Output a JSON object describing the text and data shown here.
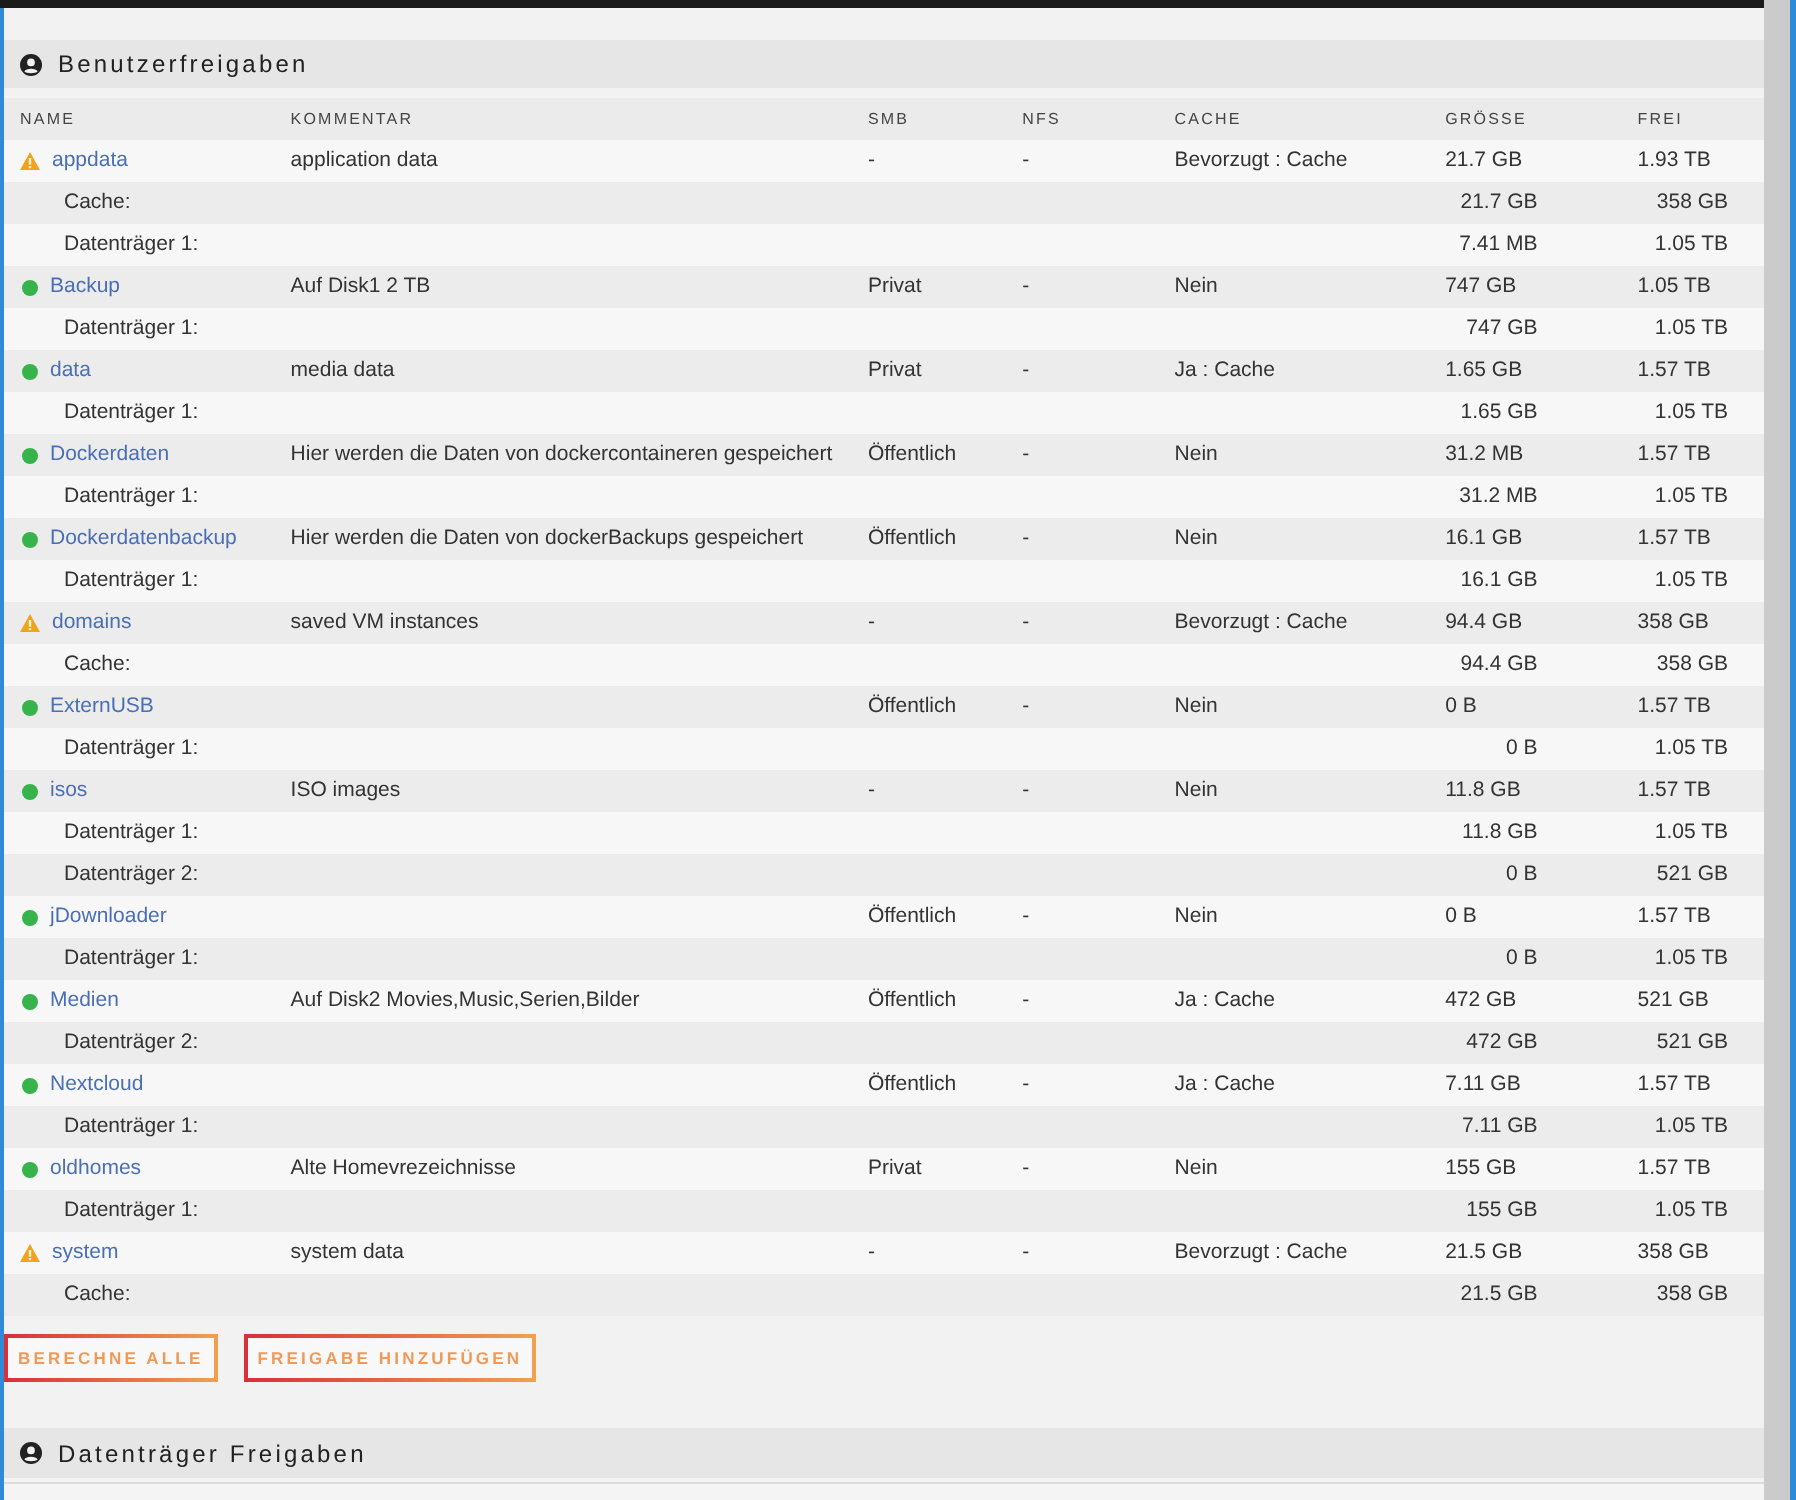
{
  "user_shares": {
    "title": "Benutzerfreigaben",
    "columns": [
      "NAME",
      "KOMMENTAR",
      "SMB",
      "NFS",
      "CACHE",
      "GRÖSSE",
      "FREI"
    ],
    "shares": [
      {
        "name": "appdata",
        "warning": true,
        "comment": "application data",
        "smb": "-",
        "nfs": "-",
        "cache": "Bevorzugt : Cache",
        "size": "21.7 GB",
        "free": "1.93 TB",
        "disks": [
          {
            "label": "Cache:",
            "size": "21.7 GB",
            "free": "358 GB"
          },
          {
            "label": "Datenträger 1:",
            "size": "7.41 MB",
            "free": "1.05 TB"
          }
        ]
      },
      {
        "name": "Backup",
        "warning": false,
        "comment": "Auf Disk1 2 TB",
        "smb": "Privat",
        "nfs": "-",
        "cache": "Nein",
        "size": "747 GB",
        "free": "1.05 TB",
        "disks": [
          {
            "label": "Datenträger 1:",
            "size": "747 GB",
            "free": "1.05 TB"
          }
        ]
      },
      {
        "name": "data",
        "warning": false,
        "comment": "media data",
        "smb": "Privat",
        "nfs": "-",
        "cache": "Ja : Cache",
        "size": "1.65 GB",
        "free": "1.57 TB",
        "disks": [
          {
            "label": "Datenträger 1:",
            "size": "1.65 GB",
            "free": "1.05 TB"
          }
        ]
      },
      {
        "name": "Dockerdaten",
        "warning": false,
        "comment": "Hier werden die Daten von dockercontaineren gespeichert",
        "smb": "Öffentlich",
        "nfs": "-",
        "cache": "Nein",
        "size": "31.2 MB",
        "free": "1.57 TB",
        "disks": [
          {
            "label": "Datenträger 1:",
            "size": "31.2 MB",
            "free": "1.05 TB"
          }
        ]
      },
      {
        "name": "Dockerdatenbackup",
        "warning": false,
        "comment": "Hier werden die Daten von dockerBackups gespeichert",
        "smb": "Öffentlich",
        "nfs": "-",
        "cache": "Nein",
        "size": "16.1 GB",
        "free": "1.57 TB",
        "disks": [
          {
            "label": "Datenträger 1:",
            "size": "16.1 GB",
            "free": "1.05 TB"
          }
        ]
      },
      {
        "name": "domains",
        "warning": true,
        "comment": "saved VM instances",
        "smb": "-",
        "nfs": "-",
        "cache": "Bevorzugt : Cache",
        "size": "94.4 GB",
        "free": "358 GB",
        "disks": [
          {
            "label": "Cache:",
            "size": "94.4 GB",
            "free": "358 GB"
          }
        ]
      },
      {
        "name": "ExternUSB",
        "warning": false,
        "smb": "Öffentlich",
        "nfs": "-",
        "cache": "Nein",
        "size": "0 B",
        "free": "1.57 TB",
        "disks": [
          {
            "label": "Datenträger 1:",
            "size": "0 B",
            "free": "1.05 TB"
          }
        ]
      },
      {
        "name": "isos",
        "warning": false,
        "comment": "ISO images",
        "smb": "-",
        "nfs": "-",
        "cache": "Nein",
        "size": "11.8 GB",
        "free": "1.57 TB",
        "disks": [
          {
            "label": "Datenträger 1:",
            "size": "11.8 GB",
            "free": "1.05 TB"
          },
          {
            "label": "Datenträger 2:",
            "size": "0 B",
            "free": "521 GB"
          }
        ]
      },
      {
        "name": "jDownloader",
        "warning": false,
        "smb": "Öffentlich",
        "nfs": "-",
        "cache": "Nein",
        "size": "0 B",
        "free": "1.57 TB",
        "disks": [
          {
            "label": "Datenträger 1:",
            "size": "0 B",
            "free": "1.05 TB"
          }
        ]
      },
      {
        "name": "Medien",
        "warning": false,
        "comment": "Auf Disk2 Movies,Music,Serien,Bilder",
        "smb": "Öffentlich",
        "nfs": "-",
        "cache": "Ja : Cache",
        "size": "472 GB",
        "free": "521 GB",
        "disks": [
          {
            "label": "Datenträger 2:",
            "size": "472 GB",
            "free": "521 GB"
          }
        ]
      },
      {
        "name": "Nextcloud",
        "warning": false,
        "smb": "Öffentlich",
        "nfs": "-",
        "cache": "Ja : Cache",
        "size": "7.11 GB",
        "free": "1.57 TB",
        "disks": [
          {
            "label": "Datenträger 1:",
            "size": "7.11 GB",
            "free": "1.05 TB"
          }
        ]
      },
      {
        "name": "oldhomes",
        "warning": false,
        "comment": "Alte Homevrezeichnisse",
        "smb": "Privat",
        "nfs": "-",
        "cache": "Nein",
        "size": "155 GB",
        "free": "1.57 TB",
        "disks": [
          {
            "label": "Datenträger 1:",
            "size": "155 GB",
            "free": "1.05 TB"
          }
        ]
      },
      {
        "name": "system",
        "warning": true,
        "comment": "system data",
        "smb": "-",
        "nfs": "-",
        "cache": "Bevorzugt : Cache",
        "size": "21.5 GB",
        "free": "358 GB",
        "disks": [
          {
            "label": "Cache:",
            "size": "21.5 GB",
            "free": "358 GB"
          }
        ]
      }
    ],
    "buttons": [
      "BERECHNE ALLE",
      "FREIGABE HINZUFÜGEN"
    ]
  },
  "disk_shares": {
    "title": "Datenträger Freigaben"
  }
}
